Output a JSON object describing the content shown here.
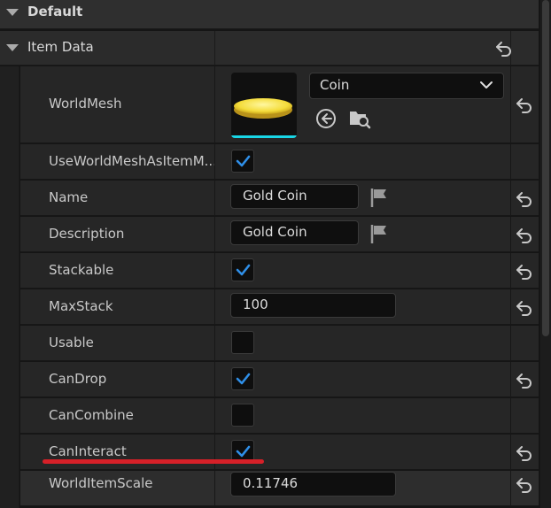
{
  "categories": {
    "default_label": "Default",
    "item_data_label": "Item Data"
  },
  "rows": {
    "world_mesh": {
      "name": "WorldMesh",
      "asset": "Coin"
    },
    "use_world_mesh": {
      "name": "UseWorldMeshAsItemM...",
      "checked": true
    },
    "name": {
      "name": "Name",
      "value": "Gold Coin"
    },
    "description": {
      "name": "Description",
      "value": "Gold Coin"
    },
    "stackable": {
      "name": "Stackable",
      "checked": true
    },
    "max_stack": {
      "name": "MaxStack",
      "value": "100"
    },
    "usable": {
      "name": "Usable",
      "checked": false
    },
    "can_drop": {
      "name": "CanDrop",
      "checked": true
    },
    "can_combine": {
      "name": "CanCombine",
      "checked": false
    },
    "can_interact": {
      "name": "CanInteract",
      "checked": true
    },
    "world_item_scale": {
      "name": "WorldItemScale",
      "value": "0.11746"
    }
  },
  "colors": {
    "accent": "#19d6e6",
    "check": "#2f8fe8",
    "highlight_underline": "#d62028"
  }
}
